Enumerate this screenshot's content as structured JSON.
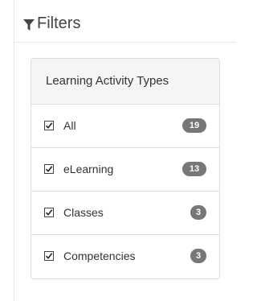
{
  "filters": {
    "title": "Filters",
    "icon": "funnel-icon"
  },
  "panel": {
    "heading": "Learning Activity Types",
    "items": [
      {
        "label": "All",
        "count": "19",
        "checked": true
      },
      {
        "label": "eLearning",
        "count": "13",
        "checked": true
      },
      {
        "label": "Classes",
        "count": "3",
        "checked": true
      },
      {
        "label": "Competencies",
        "count": "3",
        "checked": true
      }
    ]
  },
  "colors": {
    "badge": "#777777",
    "heading_bg": "#f5f5f5",
    "border": "#dddddd"
  }
}
